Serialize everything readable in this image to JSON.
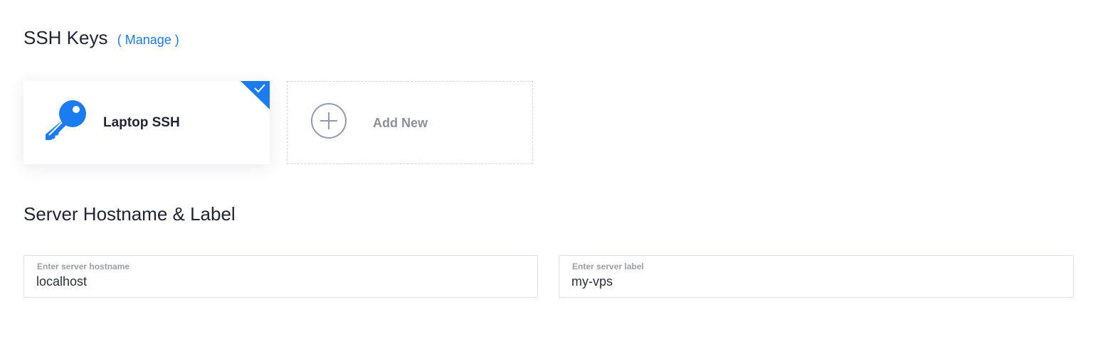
{
  "ssh_section": {
    "title": "SSH Keys",
    "manage_link": "( Manage )"
  },
  "ssh_keys": [
    {
      "label": "Laptop SSH",
      "selected": true,
      "icon": "key-icon"
    }
  ],
  "add_new": {
    "label": "Add New",
    "icon": "plus-circle-icon"
  },
  "server_section": {
    "title": "Server Hostname & Label"
  },
  "hostname_field": {
    "caption": "Enter server hostname",
    "value": "localhost"
  },
  "label_field": {
    "caption": "Enter server label",
    "value": "my-vps"
  },
  "colors": {
    "accent": "#1b7cf0",
    "text": "#1e2431",
    "muted": "#8b909a"
  }
}
